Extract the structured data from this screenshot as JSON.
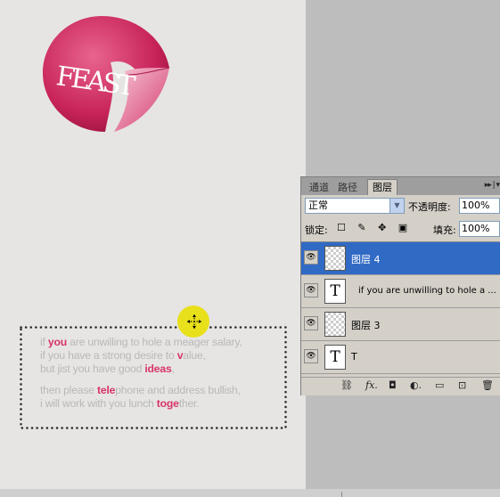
{
  "canvas": {
    "logo_text": "FEAST",
    "paragraph": [
      [
        {
          "t": "if "
        },
        {
          "t": "you",
          "hl": true
        },
        {
          "t": " are unwilling to hole a meager salary,"
        }
      ],
      [
        {
          "t": "if you have a strong desire to "
        },
        {
          "t": "v",
          "hl": true
        },
        {
          "t": "alue,"
        }
      ],
      [
        {
          "t": "but jist you have good "
        },
        {
          "t": "ideas",
          "hl": true
        },
        {
          "t": ","
        }
      ],
      [],
      [
        {
          "t": "then please "
        },
        {
          "t": "tele",
          "hl": true
        },
        {
          "t": "phone and address bullish,"
        }
      ],
      [
        {
          "t": " i will work with you lunch "
        },
        {
          "t": "toge",
          "hl": true
        },
        {
          "t": "ther."
        }
      ]
    ],
    "highlight_color": "#d8336a"
  },
  "layers_panel": {
    "tabs": [
      {
        "label": "通道",
        "active": false
      },
      {
        "label": "路径",
        "active": false
      },
      {
        "label": "图层",
        "active": true
      }
    ],
    "menu_glyph": "▸▸ | ▾",
    "blend_mode": "正常",
    "opacity_label": "不透明度:",
    "opacity_value": "100%",
    "lock_label": "锁定:",
    "lock_icons": "☐ ✎ ✥ ▣",
    "fill_label": "填充:",
    "fill_value": "100%",
    "layers": [
      {
        "name": "图层 4",
        "type": "raster",
        "selected": true
      },
      {
        "name": "if you are unwilling to hole a ...",
        "type": "text",
        "selected": false
      },
      {
        "name": "图层 3",
        "type": "raster",
        "selected": false
      },
      {
        "name": "T",
        "type": "text",
        "selected": false
      }
    ],
    "footer_icons": [
      "link-icon",
      "fx-icon",
      "mask-icon",
      "adjustment-icon",
      "group-icon",
      "new-layer-icon",
      "trash-icon"
    ],
    "footer_glyphs": [
      "⛓",
      "fx.",
      "◘",
      "◐.",
      "▭",
      "⊡",
      "🗑"
    ]
  }
}
